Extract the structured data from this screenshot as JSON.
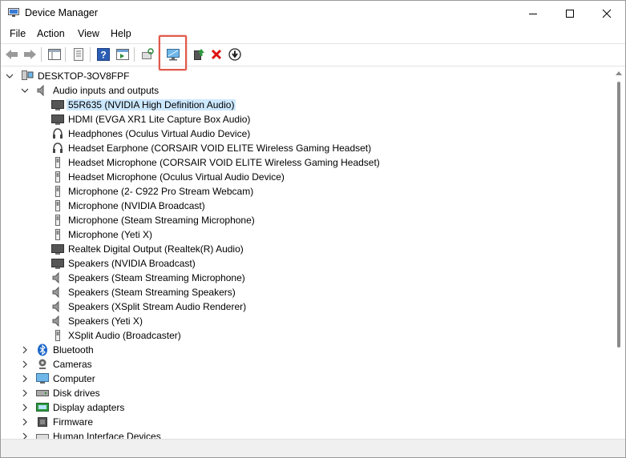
{
  "window": {
    "title": "Device Manager",
    "controls": [
      "minimize",
      "maximize",
      "close"
    ]
  },
  "menu": {
    "file": "File",
    "action": "Action",
    "view": "View",
    "help": "Help"
  },
  "toolbar": {
    "buttons": [
      "back-icon",
      "forward-icon",
      "properties-pane-icon",
      "show-hidden-icon",
      "help-icon",
      "run-icon",
      "scan-hardware-icon",
      "display-monitor-icon",
      "update-driver-icon",
      "uninstall-icon",
      "download-icon"
    ],
    "highlighted": "display-monitor-icon",
    "highlight_color": "#e05a4c"
  },
  "tree": {
    "root": "DESKTOP-3OV8FPF",
    "audio_category": "Audio inputs and outputs",
    "audio_devices": [
      "55R635 (NVIDIA High Definition Audio)",
      "HDMI (EVGA XR1 Lite Capture Box Audio)",
      "Headphones (Oculus Virtual Audio Device)",
      "Headset Earphone (CORSAIR VOID ELITE Wireless Gaming Headset)",
      "Headset Microphone (CORSAIR VOID ELITE Wireless Gaming Headset)",
      "Headset Microphone (Oculus Virtual Audio Device)",
      "Microphone (2- C922 Pro Stream Webcam)",
      "Microphone (NVIDIA Broadcast)",
      "Microphone (Steam Streaming Microphone)",
      "Microphone (Yeti X)",
      "Realtek Digital Output (Realtek(R) Audio)",
      "Speakers (NVIDIA Broadcast)",
      "Speakers (Steam Streaming Microphone)",
      "Speakers (Steam Streaming Speakers)",
      "Speakers (XSplit  Stream  Audio  Renderer)",
      "Speakers (Yeti X)",
      "XSplit Audio (Broadcaster)"
    ],
    "selected_device": "55R635 (NVIDIA High Definition Audio)",
    "categories": [
      "Bluetooth",
      "Cameras",
      "Computer",
      "Disk drives",
      "Display adapters",
      "Firmware",
      "Human Interface Devices"
    ]
  },
  "colors": {
    "selection": "#cce8ff",
    "accent": "#0078d4"
  }
}
